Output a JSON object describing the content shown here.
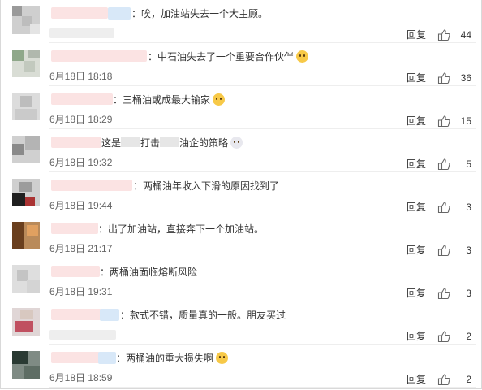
{
  "comments": [
    {
      "text": "：唉，加油站失去一个大主顾。",
      "date": "",
      "reply": "回复",
      "likes": "44"
    },
    {
      "text": "：中石油失去了一个重要合作伙伴",
      "emoji": "doge-emoji",
      "date": "6月18日 18:18",
      "reply": "回复",
      "likes": "36"
    },
    {
      "text": "：三桶油或成最大输家",
      "emoji": "doge-emoji",
      "date": "6月18日 18:29",
      "reply": "回复",
      "likes": "15"
    },
    {
      "text_a": "这是",
      "text_b": "打击",
      "text_c": "油企的策略",
      "emoji": "skull-emoji",
      "date": "6月18日 19:32",
      "reply": "回复",
      "likes": "5"
    },
    {
      "text": "：两桶油年收入下滑的原因找到了",
      "date": "6月18日 19:44",
      "reply": "回复",
      "likes": "3"
    },
    {
      "text": "：出了加油站，直接奔下一个加油站。",
      "date": "6月18日 21:17",
      "reply": "回复",
      "likes": "3"
    },
    {
      "text": "：两桶油面临熔断风险",
      "date": "6月18日 19:31",
      "reply": "回复",
      "likes": "3"
    },
    {
      "text": "：款式不错，质量真的一般。朋友买过",
      "date": "",
      "reply": "回复",
      "likes": "2"
    },
    {
      "text": "：两桶油的重大损失啊",
      "emoji": "laugh-cry-emoji",
      "date": "6月18日 18:59",
      "reply": "回复",
      "likes": "2"
    }
  ],
  "colors": {
    "text": "#333333",
    "meta": "#666666",
    "blur_pink": "#fbe3e3",
    "blur_blue": "#d8e8f8",
    "blur_gray": "#eaeaea",
    "emoji_yellow": "#f7c948"
  }
}
